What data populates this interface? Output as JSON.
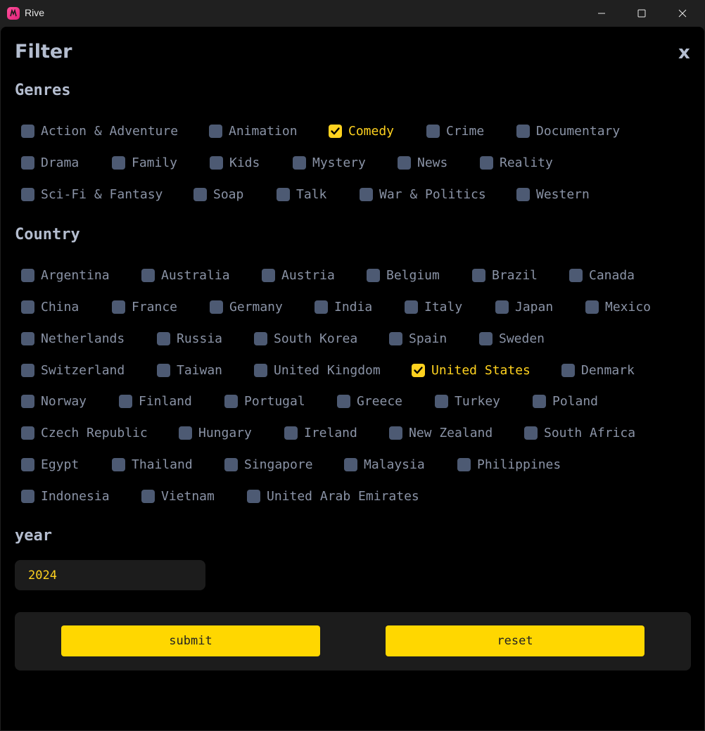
{
  "window": {
    "title": "Rive"
  },
  "header": {
    "title": "Filter",
    "close_label": "x"
  },
  "colors": {
    "accent": "#ffd21f",
    "checkbox": "#4d5a73",
    "background": "#000000"
  },
  "genres": {
    "title": "Genres",
    "items": [
      {
        "label": "Action & Adventure",
        "checked": false
      },
      {
        "label": "Animation",
        "checked": false
      },
      {
        "label": "Comedy",
        "checked": true
      },
      {
        "label": "Crime",
        "checked": false
      },
      {
        "label": "Documentary",
        "checked": false
      },
      {
        "label": "Drama",
        "checked": false
      },
      {
        "label": "Family",
        "checked": false
      },
      {
        "label": "Kids",
        "checked": false
      },
      {
        "label": "Mystery",
        "checked": false
      },
      {
        "label": "News",
        "checked": false
      },
      {
        "label": "Reality",
        "checked": false
      },
      {
        "label": "Sci-Fi & Fantasy",
        "checked": false
      },
      {
        "label": "Soap",
        "checked": false
      },
      {
        "label": "Talk",
        "checked": false
      },
      {
        "label": "War & Politics",
        "checked": false
      },
      {
        "label": "Western",
        "checked": false
      }
    ]
  },
  "country": {
    "title": "Country",
    "items": [
      {
        "label": "Argentina",
        "checked": false
      },
      {
        "label": "Australia",
        "checked": false
      },
      {
        "label": "Austria",
        "checked": false
      },
      {
        "label": "Belgium",
        "checked": false
      },
      {
        "label": "Brazil",
        "checked": false
      },
      {
        "label": "Canada",
        "checked": false
      },
      {
        "label": "China",
        "checked": false
      },
      {
        "label": "France",
        "checked": false
      },
      {
        "label": "Germany",
        "checked": false
      },
      {
        "label": "India",
        "checked": false
      },
      {
        "label": "Italy",
        "checked": false
      },
      {
        "label": "Japan",
        "checked": false
      },
      {
        "label": "Mexico",
        "checked": false
      },
      {
        "label": "Netherlands",
        "checked": false
      },
      {
        "label": "Russia",
        "checked": false
      },
      {
        "label": "South Korea",
        "checked": false
      },
      {
        "label": "Spain",
        "checked": false
      },
      {
        "label": "Sweden",
        "checked": false
      },
      {
        "label": "Switzerland",
        "checked": false
      },
      {
        "label": "Taiwan",
        "checked": false
      },
      {
        "label": "United Kingdom",
        "checked": false
      },
      {
        "label": "United States",
        "checked": true
      },
      {
        "label": "Denmark",
        "checked": false
      },
      {
        "label": "Norway",
        "checked": false
      },
      {
        "label": "Finland",
        "checked": false
      },
      {
        "label": "Portugal",
        "checked": false
      },
      {
        "label": "Greece",
        "checked": false
      },
      {
        "label": "Turkey",
        "checked": false
      },
      {
        "label": "Poland",
        "checked": false
      },
      {
        "label": "Czech Republic",
        "checked": false
      },
      {
        "label": "Hungary",
        "checked": false
      },
      {
        "label": "Ireland",
        "checked": false
      },
      {
        "label": "New Zealand",
        "checked": false
      },
      {
        "label": "South Africa",
        "checked": false
      },
      {
        "label": "Egypt",
        "checked": false
      },
      {
        "label": "Thailand",
        "checked": false
      },
      {
        "label": "Singapore",
        "checked": false
      },
      {
        "label": "Malaysia",
        "checked": false
      },
      {
        "label": "Philippines",
        "checked": false
      },
      {
        "label": "Indonesia",
        "checked": false
      },
      {
        "label": "Vietnam",
        "checked": false
      },
      {
        "label": "United Arab Emirates",
        "checked": false
      }
    ]
  },
  "year": {
    "title": "year",
    "value": "2024"
  },
  "footer": {
    "submit_label": "submit",
    "reset_label": "reset"
  }
}
